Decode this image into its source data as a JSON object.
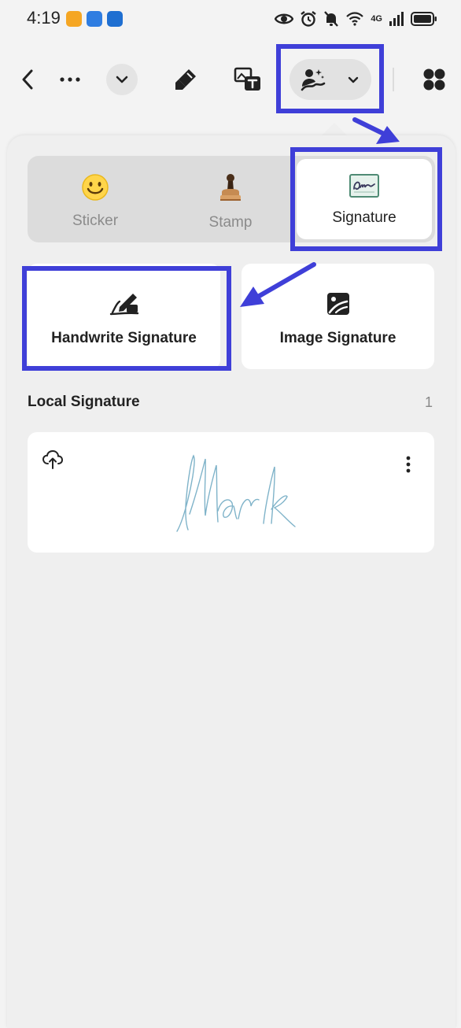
{
  "status_bar": {
    "time": "4:19",
    "network": "4G",
    "app_icons": [
      "orange-app-icon",
      "blue-app-icon",
      "blue-robot-app-icon"
    ],
    "indicators": [
      "eye-icon",
      "alarm-icon",
      "mute-icon",
      "wifi-icon",
      "signal-icon",
      "battery-icon"
    ]
  },
  "toolbar": {
    "items": [
      "back-icon",
      "more-icon",
      "chevron-down-icon",
      "highlighter-icon",
      "image-text-icon",
      "signature-tool-icon",
      "apps-grid-icon"
    ]
  },
  "tabs": [
    {
      "label": "Sticker",
      "icon": "smiley-icon",
      "active": false
    },
    {
      "label": "Stamp",
      "icon": "stamp-icon",
      "active": false
    },
    {
      "label": "Signature",
      "icon": "signature-icon",
      "active": true
    }
  ],
  "actions": {
    "handwrite": "Handwrite Signature",
    "image": "Image Signature"
  },
  "local": {
    "title": "Local Signature",
    "count": "1"
  },
  "colors": {
    "highlight": "#3f3fd8",
    "signature_ink": "#7fb3c9",
    "panel_bg": "#efefef"
  }
}
